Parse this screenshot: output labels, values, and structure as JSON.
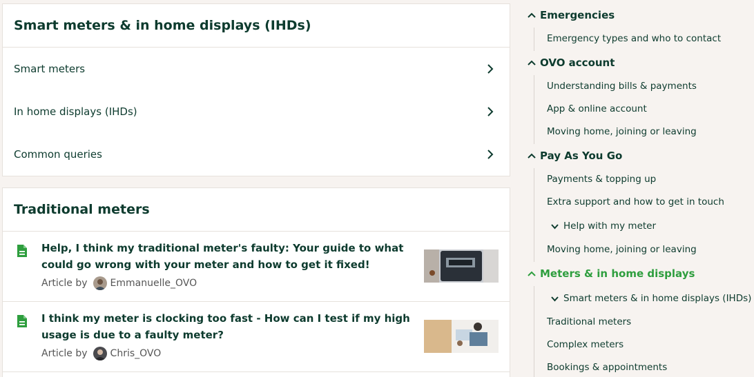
{
  "smart_card": {
    "title": "Smart meters & in home displays (IHDs)",
    "links": [
      {
        "label": "Smart meters"
      },
      {
        "label": "In home displays (IHDs)"
      },
      {
        "label": "Common queries"
      }
    ]
  },
  "traditional_card": {
    "title": "Traditional meters",
    "articles": [
      {
        "title": "Help, I think my traditional meter's faulty: Your guide to what could go wrong with your meter and how to get it fixed!",
        "byline": "Article by",
        "author": "Emmanuelle_OVO"
      },
      {
        "title": "I think my meter is clocking too fast - How can I test if my high usage is due to a faulty meter?",
        "byline": "Article by",
        "author": "Chris_OVO"
      }
    ]
  },
  "sidebar": {
    "sections": [
      {
        "label": "Emergencies",
        "items": [
          "Emergency types and who to contact"
        ]
      },
      {
        "label": "OVO account",
        "items": [
          "Understanding bills & payments",
          "App & online account",
          "Moving home, joining or leaving"
        ]
      },
      {
        "label": "Pay As You Go",
        "items": [
          "Payments & topping up",
          "Extra support and how to get in touch",
          "Help with my meter",
          "Moving home, joining or leaving"
        ]
      },
      {
        "label": "Meters & in home displays",
        "items": [
          "Smart meters & in home displays (IHDs)",
          "Traditional meters",
          "Complex meters",
          "Bookings & appointments"
        ]
      }
    ]
  },
  "colors": {
    "text": "#0d3b2e",
    "accent_green": "#2e9e3e",
    "doc_icon_green": "#2e9e3e",
    "background": "#f7f3f0",
    "card": "#ffffff"
  },
  "icons": [
    "chevron-right-icon",
    "document-icon",
    "caret-up-icon",
    "caret-down-icon"
  ]
}
